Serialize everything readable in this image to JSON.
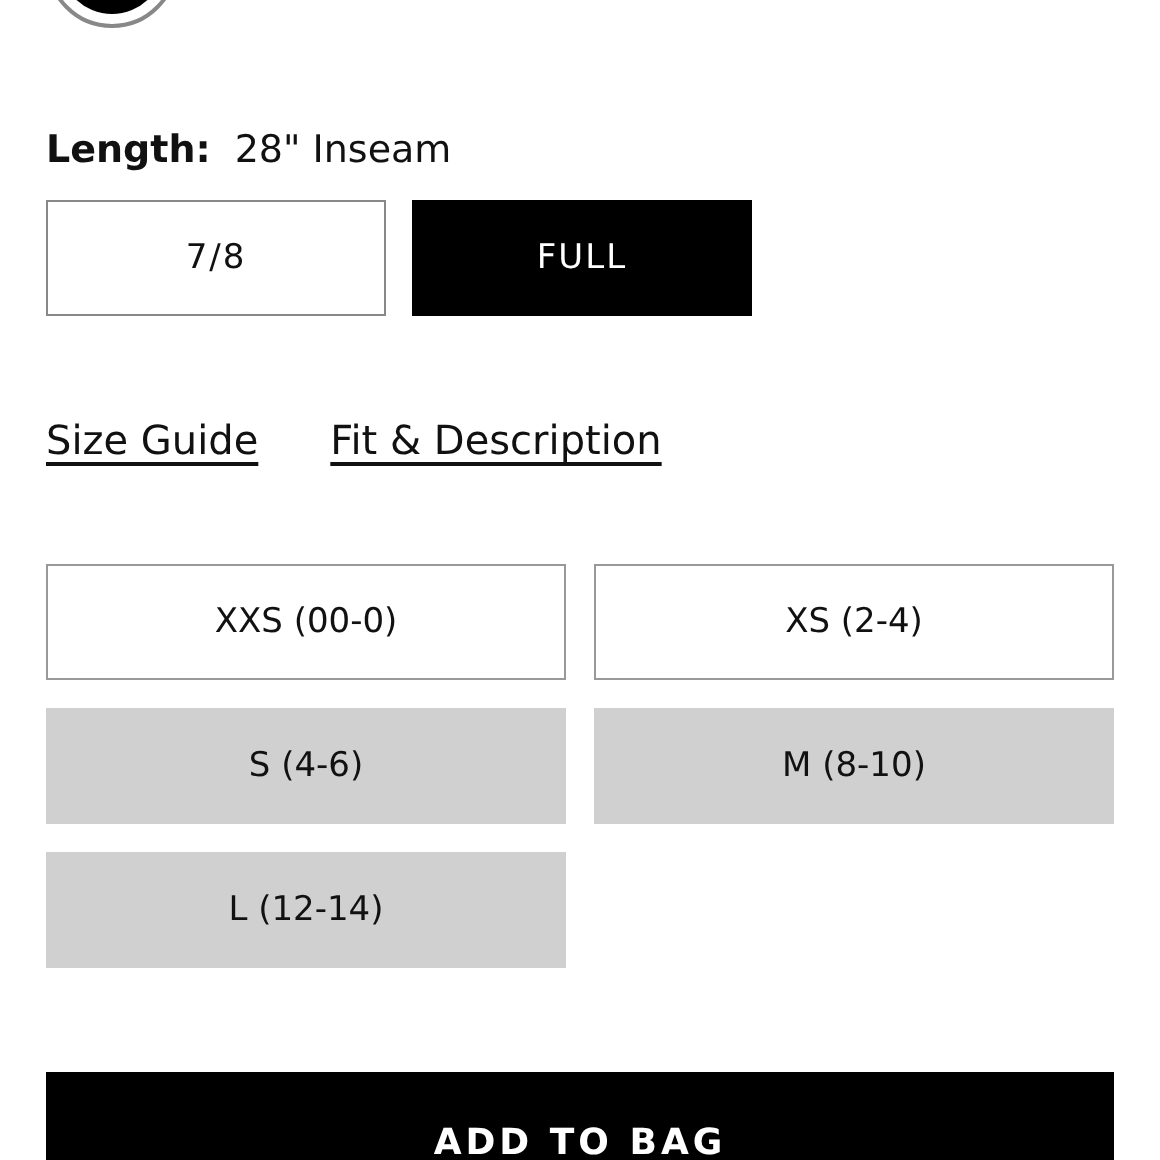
{
  "swatch": {
    "selected": true
  },
  "length": {
    "label": "Length:",
    "value": "28\" Inseam",
    "options": [
      {
        "label": "7/8",
        "selected": false
      },
      {
        "label": "FULL",
        "selected": true
      }
    ]
  },
  "links": [
    "Size Guide",
    "Fit & Description"
  ],
  "sizes": [
    {
      "label": "XXS (00-0)",
      "disabled": false
    },
    {
      "label": "XS (2-4)",
      "disabled": false
    },
    {
      "label": "S (4-6)",
      "disabled": true
    },
    {
      "label": "M (8-10)",
      "disabled": true
    },
    {
      "label": "L (12-14)",
      "disabled": true
    }
  ],
  "add_button": "ADD TO BAG"
}
